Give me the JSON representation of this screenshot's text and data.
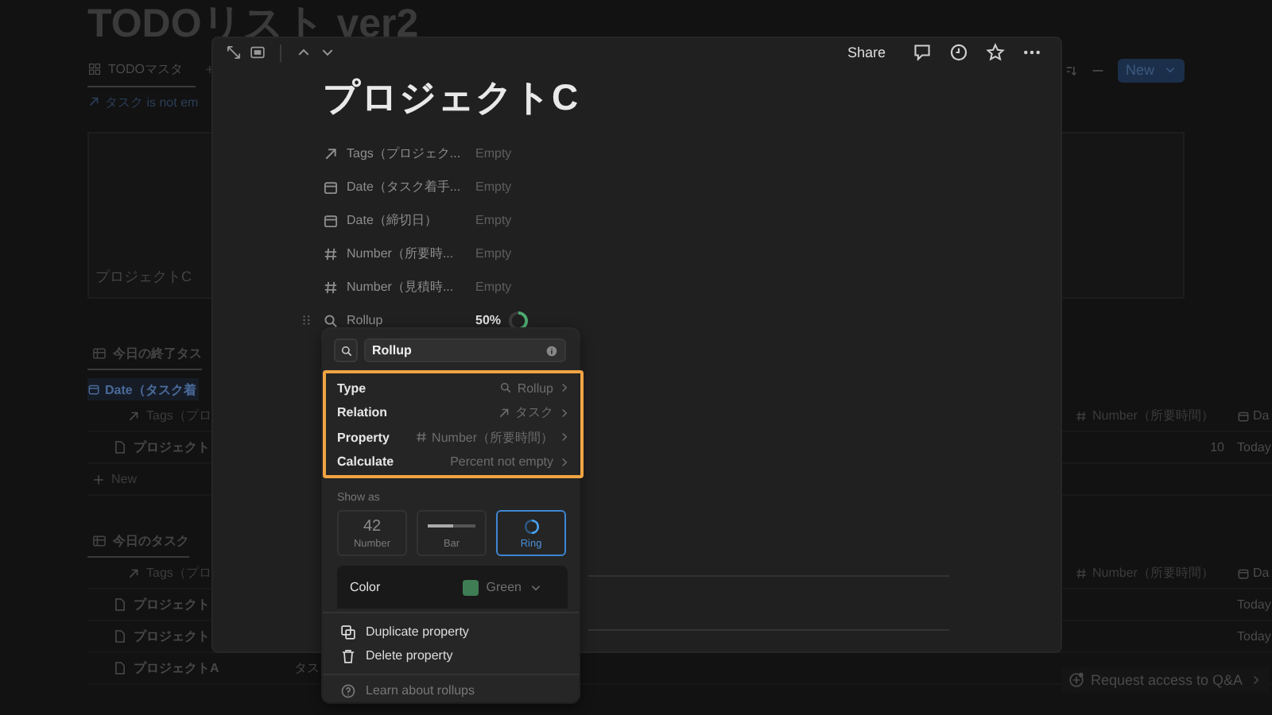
{
  "page": {
    "title": "TODOリスト ver2",
    "tab": "TODOマスタ",
    "add_tab": "+",
    "filter": "タスク is not em",
    "new_button": "New",
    "card_title": "プロジェクトC",
    "sections": [
      {
        "title": "今日の終了タス",
        "group": "Date（タスク着",
        "rows": [
          {
            "kind": "header",
            "text": "Tags（プロ",
            "number": "Number（所要時間）",
            "date": "Da"
          },
          {
            "kind": "page",
            "text": "プロジェクト",
            "number": "10",
            "date": "Today"
          },
          {
            "kind": "new",
            "text": "New"
          }
        ]
      },
      {
        "title": "今日のタスク",
        "rows": [
          {
            "kind": "header",
            "text": "Tags（プロ",
            "number": "Number（所要時間）",
            "date": "Da"
          },
          {
            "kind": "page",
            "text": "プロジェクト",
            "date": "Today"
          },
          {
            "kind": "page",
            "text": "プロジェクト",
            "date": "Today"
          },
          {
            "kind": "page",
            "text": "プロジェクトA",
            "extra": "タス"
          }
        ]
      }
    ],
    "request_access": "Request access to Q&A"
  },
  "modal": {
    "share": "Share",
    "title": "プロジェクトC",
    "properties": [
      {
        "kind": "relation",
        "name": "Tags（プロジェク...",
        "value": "Empty"
      },
      {
        "kind": "date",
        "name": "Date（タスク着手...",
        "value": "Empty"
      },
      {
        "kind": "date",
        "name": "Date（締切日）",
        "value": "Empty"
      },
      {
        "kind": "number",
        "name": "Number（所要時...",
        "value": "Empty"
      },
      {
        "kind": "number",
        "name": "Number（見積時...",
        "value": "Empty"
      },
      {
        "kind": "rollup",
        "name": "Rollup",
        "value": "50%",
        "level": 0.5
      }
    ]
  },
  "popup": {
    "name": "Rollup",
    "settings": [
      {
        "kind": "rollup",
        "label": "Type",
        "value": "Rollup"
      },
      {
        "kind": "relation",
        "label": "Relation",
        "value": "タスク"
      },
      {
        "kind": "number",
        "label": "Property",
        "value": "Number（所要時間）"
      },
      {
        "kind": "plain",
        "label": "Calculate",
        "value": "Percent not empty"
      }
    ],
    "show_as_label": "Show as",
    "show_as": [
      {
        "kind": "number",
        "sample": "42",
        "label": "Number",
        "selected": false
      },
      {
        "kind": "bar",
        "label": "Bar",
        "selected": false
      },
      {
        "kind": "ring",
        "label": "Ring",
        "selected": true
      }
    ],
    "color": {
      "label": "Color",
      "value": "Green",
      "color": "#3f7d55"
    },
    "actions": [
      {
        "kind": "duplicate",
        "label": "Duplicate property"
      },
      {
        "kind": "delete",
        "label": "Delete property"
      }
    ],
    "help": "Learn about rollups"
  }
}
